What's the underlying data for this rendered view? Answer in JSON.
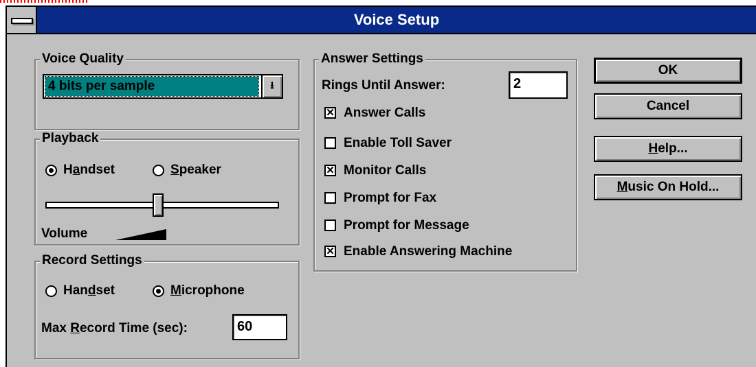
{
  "window": {
    "title": "Voice Setup"
  },
  "voice_quality": {
    "legend": "Voice Quality",
    "selected": "4 bits per sample"
  },
  "playback": {
    "legend": "Playback",
    "handset_label": "Handset",
    "speaker_label": "Speaker",
    "selected": "Handset",
    "volume_label": "Volume",
    "volume_level": 0.49
  },
  "record": {
    "legend": "Record Settings",
    "handset_label": "Handset",
    "microphone_label": "Microphone",
    "selected": "Microphone",
    "max_time_label": "Max Record Time (sec):",
    "max_time_value": "60"
  },
  "answer": {
    "legend": "Answer Settings",
    "rings_label": "Rings Until Answer:",
    "rings_value": "2",
    "options": [
      {
        "label": "Answer Calls",
        "checked": true
      },
      {
        "label": "Enable Toll Saver",
        "checked": false
      },
      {
        "label": "Monitor Calls",
        "checked": true
      },
      {
        "label": "Prompt for Fax",
        "checked": false
      },
      {
        "label": "Prompt for Message",
        "checked": false
      },
      {
        "label": "Enable Answering Machine",
        "checked": true
      }
    ]
  },
  "buttons": {
    "ok": "OK",
    "cancel": "Cancel",
    "help": "Help...",
    "music": "Music On Hold..."
  }
}
